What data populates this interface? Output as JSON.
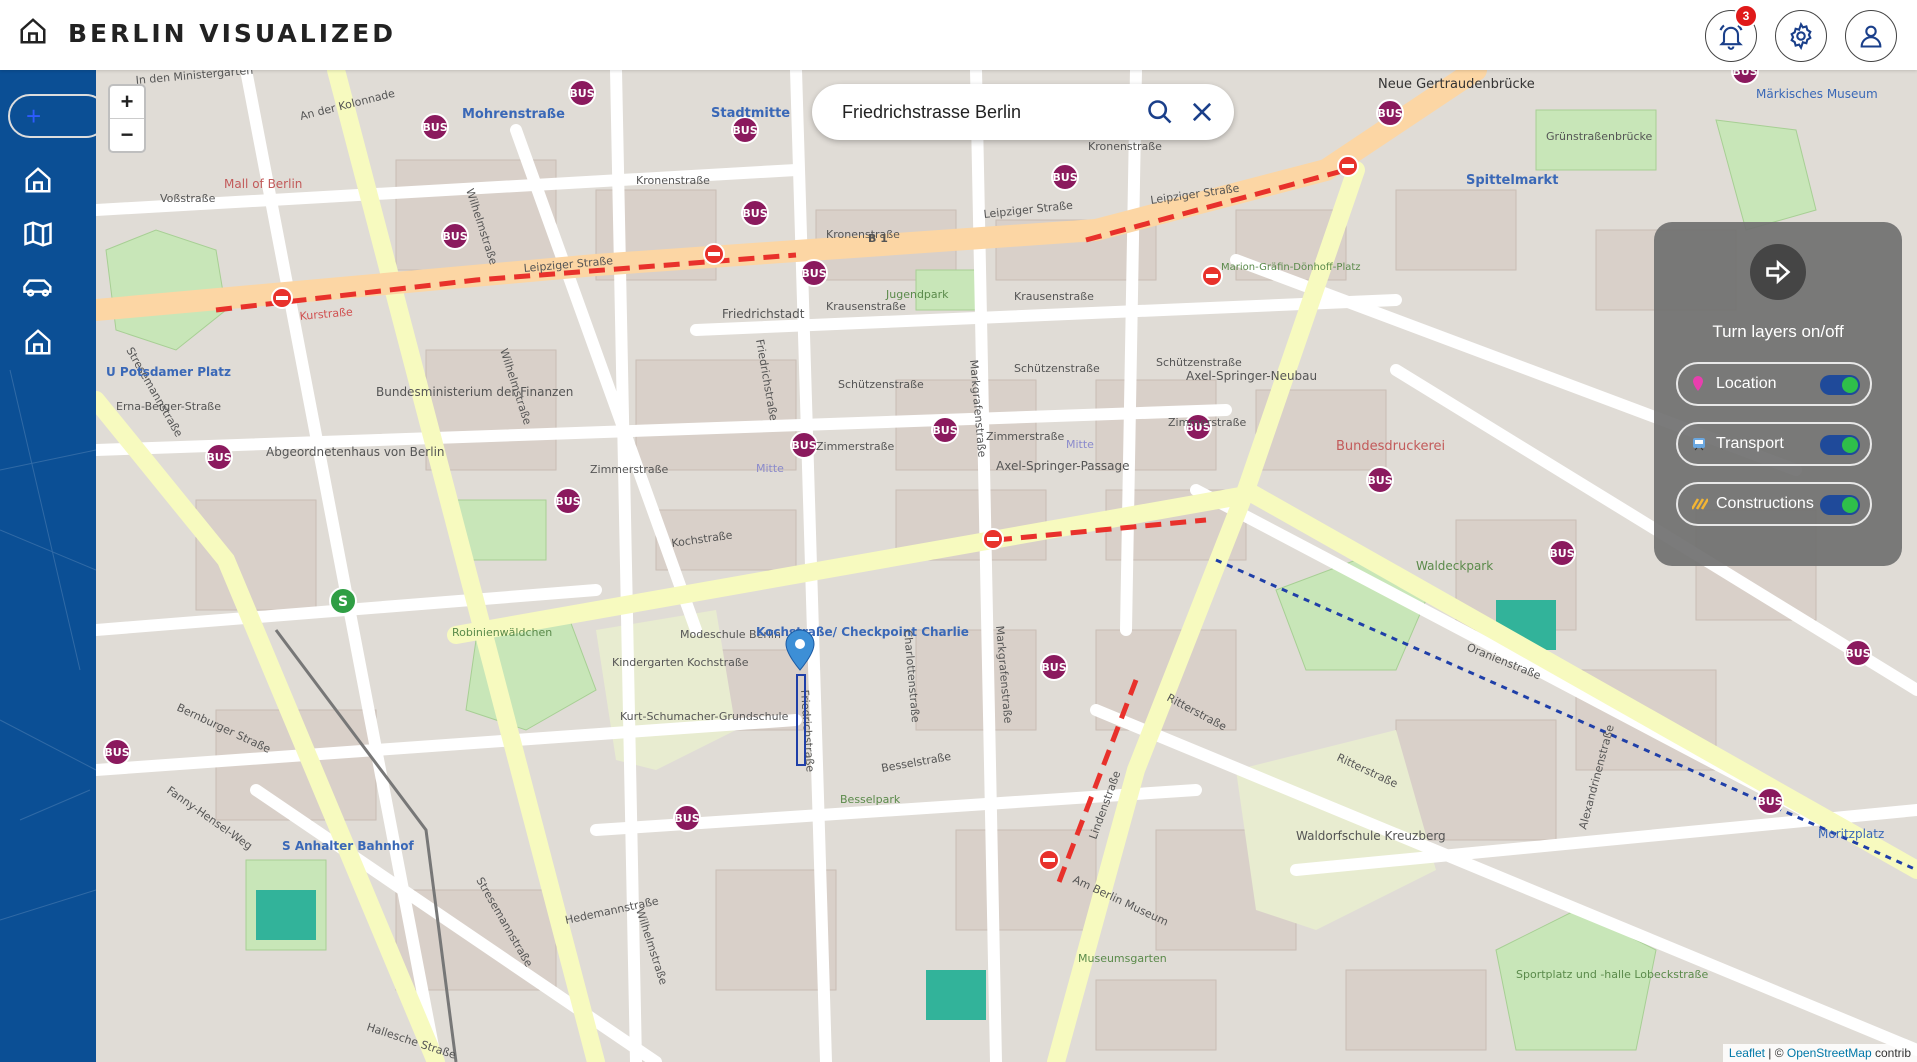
{
  "header": {
    "title": "BERLIN VISUALIZED",
    "notifications_count": "3"
  },
  "sidebar": {
    "add_label": "+",
    "items": [
      "home",
      "map",
      "car",
      "home"
    ]
  },
  "map": {
    "zoom_in": "+",
    "zoom_out": "−",
    "search": {
      "value": "Friedrichstrasse Berlin"
    },
    "labels": {
      "mohrenstrasse": "Mohrenstraße",
      "stadtmitte": "Stadtmitte",
      "leipziger1": "Leipziger Straße",
      "leipziger2": "Leipziger Straße",
      "leipziger3": "Leipziger Straße",
      "kronenstrasse": "Kronenstraße",
      "krausenstrasse": "Krausenstraße",
      "schuetzenstrasse": "Schützenstraße",
      "zimmerstrasse": "Zimmerstraße",
      "kochstrasse": "Kochstraße",
      "friedrichstadt": "Friedrichstadt",
      "friedrichstrasse": "Friedrichstraße",
      "wilhelmstrasse": "Wilhelmstraße",
      "stresemannstrasse": "Stresemannstraße",
      "mall": "Mall of Berlin",
      "potsdamer": "U Potsdamer Platz",
      "bundes": "Bundesministerium der Finanzen",
      "abgeordneten": "Abgeordnetenhaus von Berlin",
      "erna": "Erna-Berger-Straße",
      "spittelmarkt": "Spittelmarkt",
      "gertrauden": "Neue Gertraudenbrücke",
      "maerkisches": "Märkisches Museum",
      "gruenstrasse": "Grünstraßenbrücke",
      "axel1": "Axel-Springer-Neubau",
      "axel2": "Axel-Springer-Passage",
      "bundesdruckerei": "Bundesdruckerei",
      "waldeckpark": "Waldeckpark",
      "oranienstrasse": "Oranienstraße",
      "ritterstrasse": "Ritterstraße",
      "waldorf": "Waldorfschule Kreuzberg",
      "moritzplatz": "Moritzplatz",
      "sportplatz": "Sportplatz und -halle Lobeckstraße",
      "anhalter": "S Anhalter Bahnhof",
      "robinien": "Robinienwäldchen",
      "modeschule": "Modeschule Berlin",
      "kindergarten": "Kindergarten Kochstraße",
      "kurt": "Kurt-Schumacher-Grundschule",
      "checkpoint": "Kochstraße/ Checkpoint Charlie",
      "bessel": "Besselpark",
      "besselstrasse": "Besselstraße",
      "charlotten": "Charlottenstraße",
      "markgrafen": "Markgrafenstraße",
      "lindenstrasse": "Lindenstraße",
      "hedemann": "Hedemannstraße",
      "museumsgarten": "Museumsgarten",
      "amberlin": "Am Berlin Museum",
      "mitte1": "Mitte",
      "mitte2": "Mitte",
      "jugendpark": "Jugendpark",
      "marion": "Marion-Gräfin-Dönhoff-Platz",
      "bernburger": "Bernburger Straße",
      "hallesche": "Hallesche Straße",
      "alexandrinen": "Alexandrinenstraße",
      "fanny": "Fanny-Hensel-Weg",
      "b1": "B 1",
      "kurstrasse": "Kurstraße",
      "vossstrasse": "Voßstraße",
      "kolonnade": "An der Kolonnade",
      "ministergarten": "In den Ministergärten"
    },
    "bus_label": "BUS",
    "layers_panel": {
      "title": "Turn layers on/off",
      "items": [
        {
          "label": "Location",
          "on": true
        },
        {
          "label": "Transport",
          "on": true
        },
        {
          "label": "Constructions",
          "on": true
        }
      ]
    },
    "attribution": {
      "leaflet": "Leaflet",
      "sep": " | © ",
      "osm": "OpenStreetMap",
      "rest": " contrib"
    }
  },
  "colors": {
    "sidebar": "#0b4f95",
    "construction": "#e8312b",
    "toggle_on": "#2fbf4a"
  }
}
